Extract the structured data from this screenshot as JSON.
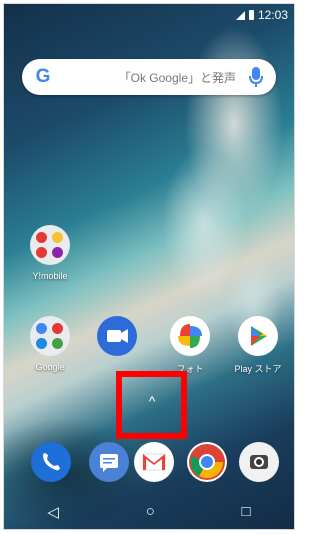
{
  "status_bar": {
    "time": "12:03"
  },
  "search": {
    "placeholder": "「Ok Google」と発声",
    "google_glyph": "G"
  },
  "home": {
    "folder_ymobile": {
      "label": "Y!mobile"
    },
    "folder_google": {
      "label": "Google"
    },
    "app_duo": {
      "label": ""
    },
    "app_photos": {
      "label": "フォト"
    },
    "app_playstore": {
      "label": "Play ストア"
    }
  },
  "app_drawer": {
    "arrow_glyph": "^"
  },
  "dock": [
    "phone",
    "messages",
    "gmail",
    "chrome",
    "camera"
  ],
  "nav": {
    "back_glyph": "◁",
    "home_glyph": "○",
    "recents_glyph": "□"
  },
  "colors": {
    "google_blue": "#4285f4",
    "highlight": "#ff0000",
    "phone": "#1f6fd8",
    "messages": "#4a82d8"
  }
}
